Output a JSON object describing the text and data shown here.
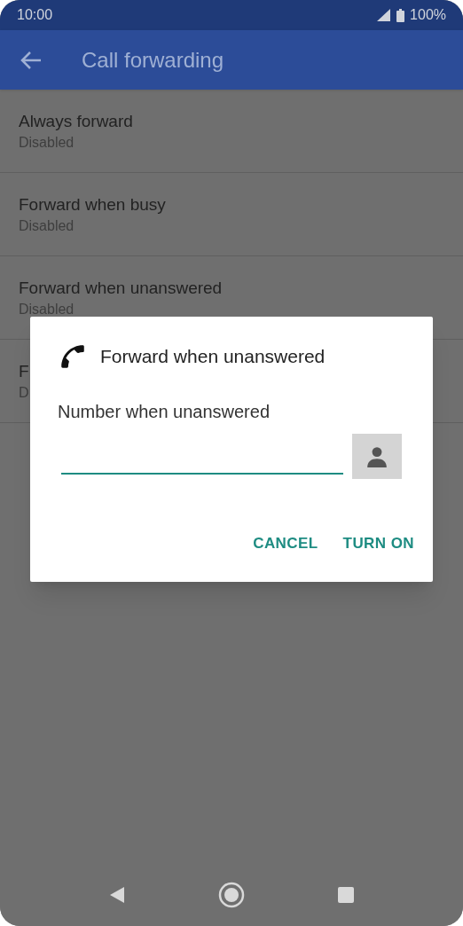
{
  "status_bar": {
    "time": "10:00",
    "battery": "100%"
  },
  "app_bar": {
    "title": "Call forwarding"
  },
  "settings": [
    {
      "title": "Always forward",
      "subtitle": "Disabled"
    },
    {
      "title": "Forward when busy",
      "subtitle": "Disabled"
    },
    {
      "title": "Forward when unanswered",
      "subtitle": "Disabled"
    },
    {
      "title": "F",
      "subtitle": "D"
    }
  ],
  "dialog": {
    "title": "Forward when unanswered",
    "field_label": "Number when unanswered",
    "buttons": [
      "CANCEL",
      "TURN ON"
    ]
  }
}
